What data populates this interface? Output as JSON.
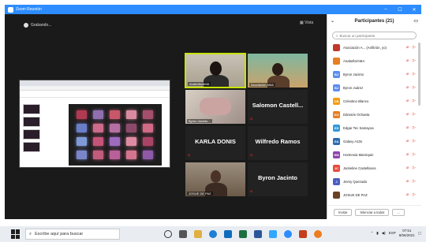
{
  "window": {
    "title": "Zoom Reunión",
    "controls": [
      "–",
      "☐",
      "✕"
    ]
  },
  "meeting_bar": {
    "recording_label": "Grabando...",
    "view_label": "Vista"
  },
  "shared_screen": {
    "description_text": ""
  },
  "video_tiles": [
    {
      "id": "anabella",
      "label": "Anabella/AMA",
      "active": true,
      "kind": "video"
    },
    {
      "id": "asociacion",
      "label": "Asociación AMA",
      "active": false,
      "kind": "video"
    },
    {
      "id": "tile3",
      "label": "Byron Jacinto...",
      "active": false,
      "kind": "video"
    },
    {
      "id": "salomon",
      "name": "Salomon Castell...",
      "active": false,
      "kind": "name"
    },
    {
      "id": "karla",
      "name": "KARLA DONIS",
      "active": false,
      "kind": "name"
    },
    {
      "id": "wilfredo",
      "name": "Wilfredo Ramos",
      "active": false,
      "kind": "name"
    },
    {
      "id": "josue",
      "label": "JOSUE DE PAZ",
      "active": false,
      "kind": "video"
    },
    {
      "id": "byron",
      "name": "Byron Jacinto",
      "active": false,
      "kind": "name"
    }
  ],
  "participants": {
    "title": "Participantes (21)",
    "search_placeholder": "Buscar un participante",
    "items": [
      {
        "initials": "",
        "name": "Asociación A... (Anfitrión, yo)",
        "color": "#c0392b",
        "photo": true
      },
      {
        "initials": "",
        "name": "Anabella/AMA",
        "color": "#e67e22",
        "photo": true
      },
      {
        "initials": "BJ",
        "name": "Byron Jacinto",
        "color": "#5b8def"
      },
      {
        "initials": "BJ",
        "name": "Byron Juárez",
        "color": "#5b8def"
      },
      {
        "initials": "CB",
        "name": "Celestino Blanco",
        "color": "#f39c12"
      },
      {
        "initials": "DO",
        "name": "Dámaris Ochaeta",
        "color": "#e67e22"
      },
      {
        "initials": "ES",
        "name": "Edgar Tec Samayoa",
        "color": "#3498db"
      },
      {
        "initials": "GA",
        "name": "Galaxy A10s",
        "color": "#2b6cb0"
      },
      {
        "initials": "HM",
        "name": "Hortensia Manriquin",
        "color": "#8e44ad"
      },
      {
        "initials": "JC",
        "name": "Jackeline Castellanos",
        "color": "#e74c3c"
      },
      {
        "initials": "J",
        "name": "Jeimy Quezada",
        "color": "#4a5fc1"
      },
      {
        "initials": "",
        "name": "JOSUE DE PAZ",
        "color": "#6b4226",
        "photo": true
      }
    ],
    "footer_buttons": [
      "Invitar",
      "Silenciar a todos",
      "..."
    ]
  },
  "taskbar": {
    "search_placeholder": "Escribe aquí para buscar",
    "time": "07:51",
    "date": "8/06/2021",
    "lang": "ESP"
  },
  "colors": {
    "accent": "#2d8cff",
    "active_speaker": "#c6e400",
    "mute_red": "#e02828"
  }
}
